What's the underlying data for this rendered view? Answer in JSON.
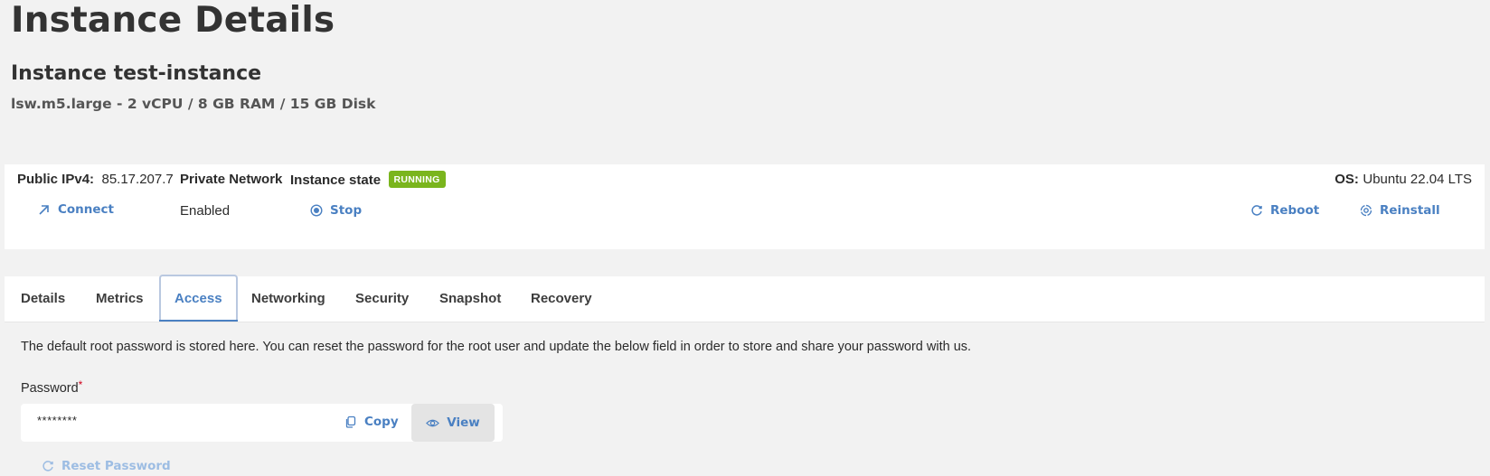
{
  "header": {
    "title": "Instance Details",
    "instance_name": "Instance test-instance",
    "instance_spec": "lsw.m5.large - 2 vCPU / 8 GB RAM / 15 GB Disk"
  },
  "summary": {
    "public_ipv4_label": "Public IPv4:",
    "public_ipv4_value": "85.17.207.7",
    "connect_label": "Connect",
    "private_network_label": "Private Network",
    "private_network_value": "Enabled",
    "instance_state_label": "Instance state",
    "instance_state_badge": "RUNNING",
    "stop_label": "Stop",
    "os_label": "OS:",
    "os_value": "Ubuntu 22.04 LTS",
    "reboot_label": "Reboot",
    "reinstall_label": "Reinstall",
    "colors": {
      "accent": "#4a80c2",
      "running": "#7ab51d"
    }
  },
  "tabs": [
    {
      "label": "Details"
    },
    {
      "label": "Metrics"
    },
    {
      "label": "Access",
      "active": true
    },
    {
      "label": "Networking"
    },
    {
      "label": "Security"
    },
    {
      "label": "Snapshot"
    },
    {
      "label": "Recovery"
    }
  ],
  "access": {
    "description": "The default root password is stored here. You can reset the password for the root user and update the below field in order to store and share your password with us.",
    "password_label": "Password",
    "required_marker": "*",
    "password_value": "********",
    "copy_label": "Copy",
    "view_label": "View",
    "reset_label": "Reset Password"
  }
}
